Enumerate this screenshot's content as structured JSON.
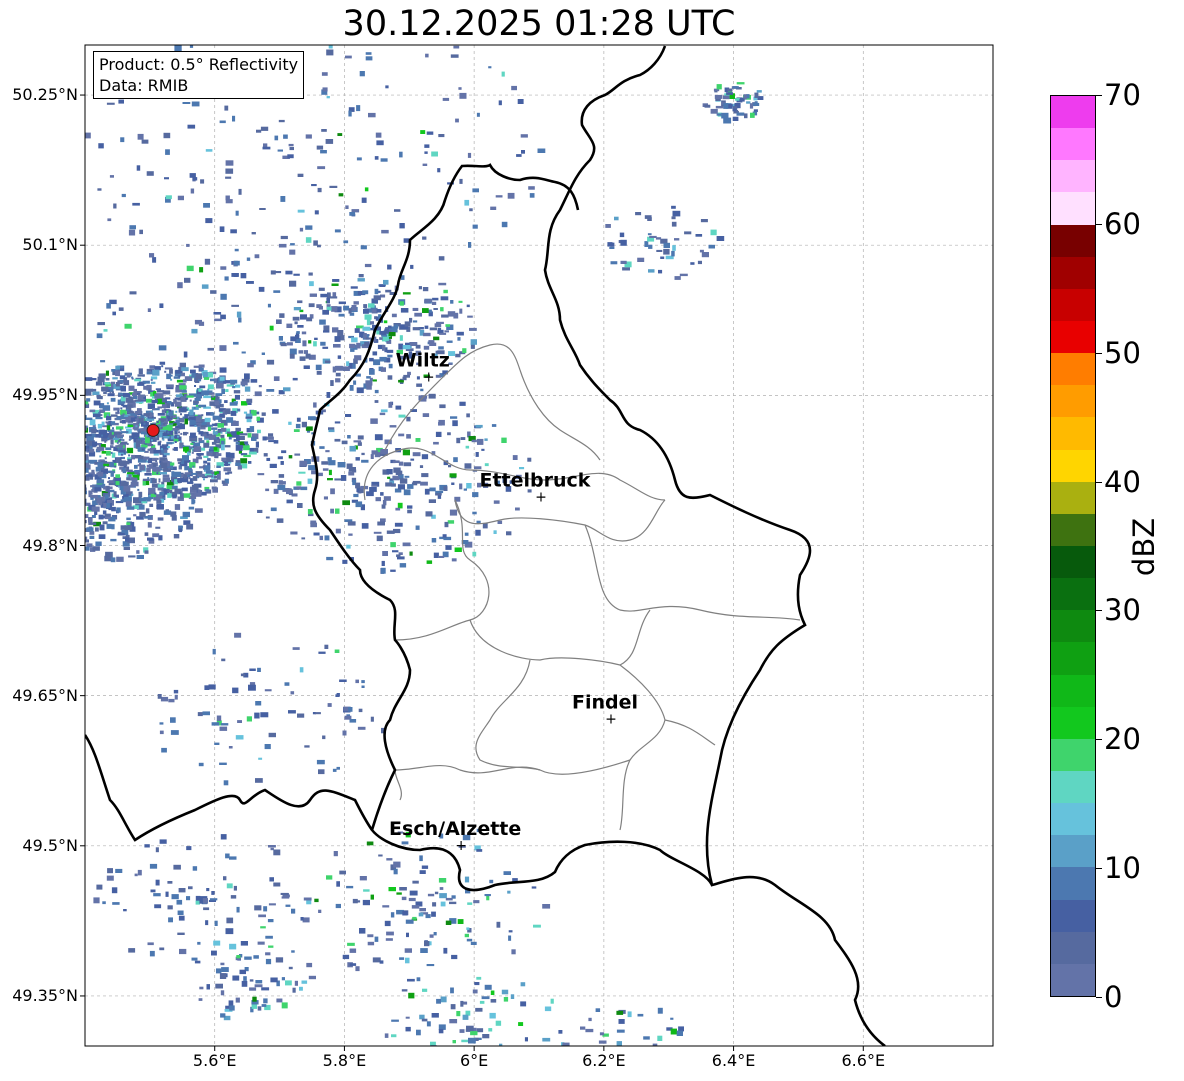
{
  "title": "30.12.2025 01:28 UTC",
  "info": {
    "product": "Product: 0.5° Reflectivity",
    "data": "Data: RMIB"
  },
  "axes": {
    "lon_range": [
      5.4,
      6.8
    ],
    "lat_range": [
      49.3,
      50.3
    ],
    "x_ticks": [
      {
        "value": 5.6,
        "label": "5.6°E"
      },
      {
        "value": 5.8,
        "label": "5.8°E"
      },
      {
        "value": 6.0,
        "label": "6°E"
      },
      {
        "value": 6.2,
        "label": "6.2°E"
      },
      {
        "value": 6.4,
        "label": "6.4°E"
      },
      {
        "value": 6.6,
        "label": "6.6°E"
      }
    ],
    "y_ticks": [
      {
        "value": 50.25,
        "label": "50.25°N"
      },
      {
        "value": 50.1,
        "label": "50.1°N"
      },
      {
        "value": 49.95,
        "label": "49.95°N"
      },
      {
        "value": 49.8,
        "label": "49.8°N"
      },
      {
        "value": 49.65,
        "label": "49.65°N"
      },
      {
        "value": 49.5,
        "label": "49.5°N"
      },
      {
        "value": 49.35,
        "label": "49.35°N"
      }
    ],
    "grid": true
  },
  "cities": [
    {
      "name": "Wiltz",
      "lon": 5.93,
      "lat": 49.968
    },
    {
      "name": "Ettelbruck",
      "lon": 6.103,
      "lat": 49.848
    },
    {
      "name": "Findel",
      "lon": 6.211,
      "lat": 49.626
    },
    {
      "name": "Esch/Alzette",
      "lon": 5.98,
      "lat": 49.5
    }
  ],
  "radar_site": {
    "lon": 5.505,
    "lat": 49.915,
    "color": "#e41a1c"
  },
  "colorbar": {
    "label": "dBZ",
    "min": 0,
    "max": 70,
    "ticks": [
      {
        "value": 0,
        "label": "0"
      },
      {
        "value": 10,
        "label": "10"
      },
      {
        "value": 20,
        "label": "20"
      },
      {
        "value": 30,
        "label": "30"
      },
      {
        "value": 40,
        "label": "40"
      },
      {
        "value": 50,
        "label": "50"
      },
      {
        "value": 60,
        "label": "60"
      },
      {
        "value": 70,
        "label": "70"
      }
    ],
    "colors": [
      "#6373a8",
      "#566a9f",
      "#4660a2",
      "#4c78b0",
      "#5aa0c8",
      "#66c2dc",
      "#5fd6c2",
      "#3fd46c",
      "#12c81e",
      "#10b818",
      "#0fa012",
      "#0e8a10",
      "#0a7010",
      "#075a0c",
      "#3e7210",
      "#aab010",
      "#ffd500",
      "#ffba00",
      "#ff9c00",
      "#ff7d00",
      "#e80000",
      "#c80000",
      "#a00000",
      "#780000",
      "#ffe0ff",
      "#ffb4ff",
      "#ff78ff",
      "#ee3cee"
    ]
  },
  "colors": {
    "country_border": "#000000",
    "canton_border": "#808080",
    "grid": "#b0b0b0"
  }
}
